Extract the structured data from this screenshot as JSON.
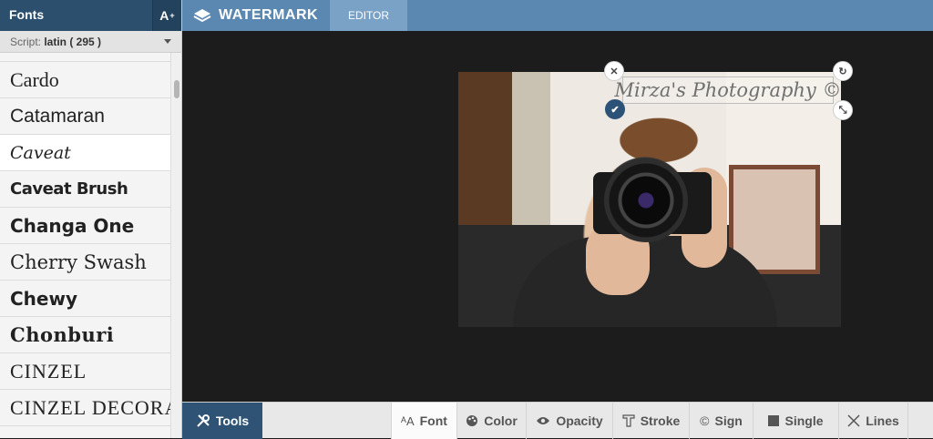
{
  "sidebar": {
    "title": "Fonts",
    "add_font_label": "A",
    "add_font_sup": "+",
    "script_prefix": "Script: ",
    "script_value": "latin ( 295 )",
    "fonts": [
      {
        "label": "Cardo",
        "family": "Liberation Serif",
        "size": 22,
        "weight": "normal",
        "style": "normal",
        "caps": "none",
        "spacing": "0px"
      },
      {
        "label": "Catamaran",
        "family": "Liberation Sans",
        "size": 21,
        "weight": "normal",
        "style": "normal",
        "caps": "none",
        "spacing": "0px"
      },
      {
        "label": "Caveat",
        "family": "DejaVu Serif",
        "size": 19,
        "weight": "normal",
        "style": "italic",
        "caps": "none",
        "spacing": "0px",
        "selected": true
      },
      {
        "label": "Caveat Brush",
        "family": "DejaVu Sans",
        "size": 18,
        "weight": "bold",
        "style": "normal",
        "caps": "none",
        "spacing": "-0.5px"
      },
      {
        "label": "Changa One",
        "family": "DejaVu Sans",
        "size": 20,
        "weight": "bold",
        "style": "normal",
        "caps": "none",
        "spacing": "0px"
      },
      {
        "label": "Cherry Swash",
        "family": "DejaVu Serif",
        "size": 21,
        "weight": "normal",
        "style": "normal",
        "caps": "none",
        "spacing": "0px"
      },
      {
        "label": "Chewy",
        "family": "DejaVu Sans",
        "size": 20,
        "weight": "bold",
        "style": "normal",
        "caps": "none",
        "spacing": "0px"
      },
      {
        "label": "Chonburi",
        "family": "DejaVu Serif",
        "size": 21,
        "weight": "bold",
        "style": "normal",
        "caps": "none",
        "spacing": "0.5px"
      },
      {
        "label": "Cinzel",
        "family": "Liberation Serif",
        "size": 22,
        "weight": "normal",
        "style": "normal",
        "caps": "uppercase",
        "spacing": "1px"
      },
      {
        "label": "Cinzel Decorative",
        "family": "Liberation Serif",
        "size": 22,
        "weight": "normal",
        "style": "normal",
        "caps": "uppercase",
        "spacing": "1px"
      }
    ]
  },
  "topbar": {
    "brand": "WATERMARK",
    "tab": "EDITOR"
  },
  "watermark": {
    "text": "Mirza's Photography ©"
  },
  "toolbar": {
    "tools_label": "Tools",
    "items": {
      "font": "Font",
      "color": "Color",
      "opacity": "Opacity",
      "stroke": "Stroke",
      "sign": "Sign",
      "single": "Single",
      "lines": "Lines"
    }
  },
  "colors": {
    "header": "#2c4f6e",
    "topbar": "#5b88b1",
    "tab": "#7aa2c6",
    "canvas": "#1c1c1c",
    "tools_button": "#2f5374"
  }
}
